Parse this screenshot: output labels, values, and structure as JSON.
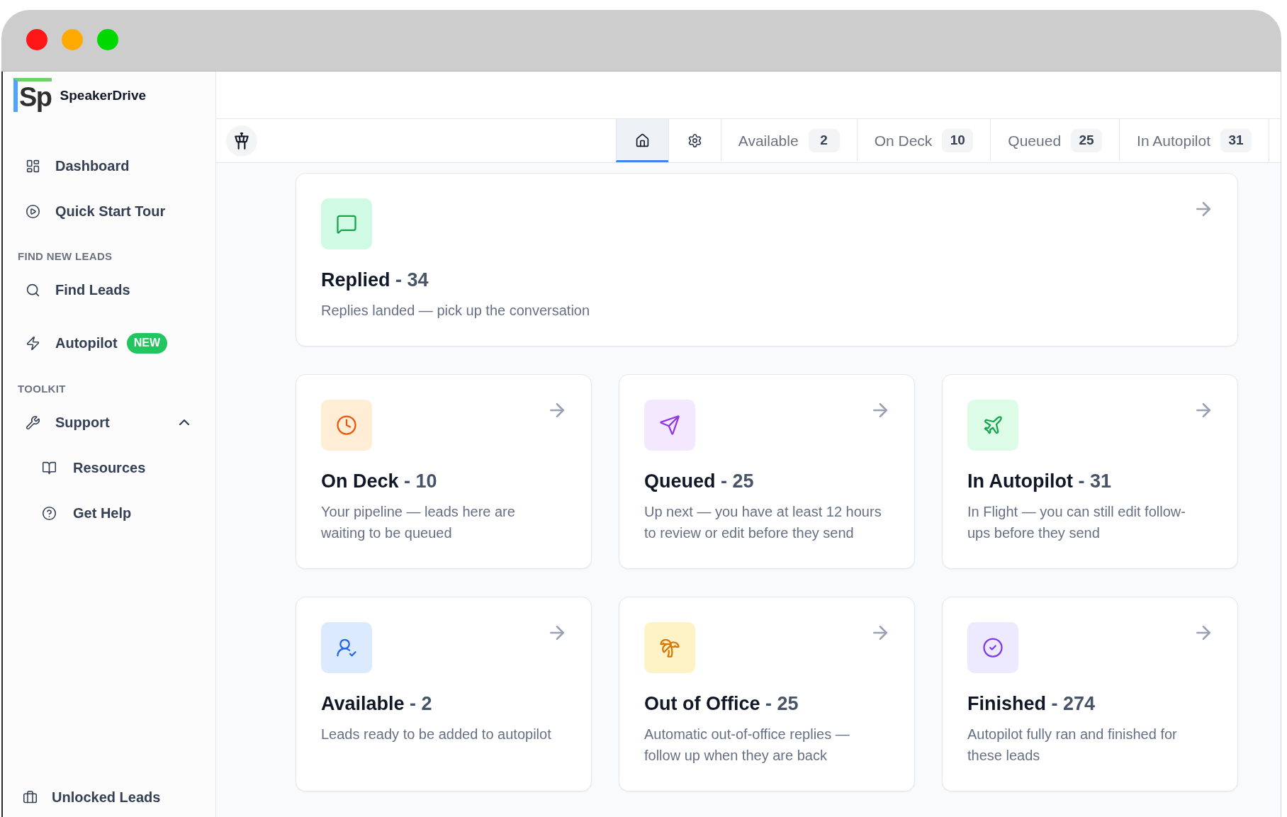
{
  "sidebar": {
    "brand": {
      "logo": "Sp",
      "name": "SpeakerDrive"
    },
    "sections": [
      {
        "items": [
          {
            "label": "Dashboard"
          },
          {
            "label": "Quick Start Tour"
          }
        ]
      },
      {
        "heading": "FIND NEW LEADS",
        "items": [
          {
            "label": "Find Leads"
          },
          {
            "label": "Autopilot",
            "badge": "NEW"
          }
        ]
      },
      {
        "heading": "TOOLKIT",
        "items": [
          {
            "label": "Support",
            "expanded": true,
            "children": [
              {
                "label": "Resources"
              },
              {
                "label": "Get Help"
              }
            ]
          }
        ]
      }
    ],
    "footer_item": {
      "label": "Unlocked Leads"
    }
  },
  "tabs": [
    {
      "kind": "icon",
      "selected": true
    },
    {
      "kind": "icon",
      "selected": false
    },
    {
      "kind": "count",
      "label": "Available",
      "count": "2",
      "selected": false
    },
    {
      "kind": "count",
      "label": "On Deck",
      "count": "10",
      "selected": false
    },
    {
      "kind": "count",
      "label": "Queued",
      "count": "25",
      "selected": false
    },
    {
      "kind": "count",
      "label": "In Autopilot",
      "count": "31",
      "selected": false
    }
  ],
  "cards": [
    {
      "title": "Replied",
      "count": "- 34",
      "description": "Replies landed — pick up the conversation"
    },
    {
      "title": "On Deck",
      "count": "- 10",
      "description": "Your pipeline — leads here are waiting to be queued"
    },
    {
      "title": "Queued",
      "count": "- 25",
      "description": "Up next — you have at least 12 hours to review or edit before they send"
    },
    {
      "title": "In Autopilot",
      "count": "- 31",
      "description": "In Flight — you can still edit follow-ups before they send"
    },
    {
      "title": "Available",
      "count": "- 2",
      "description": "Leads ready to be added to autopilot"
    },
    {
      "title": "Out of Office",
      "count": "- 25",
      "description": "Automatic out-of-office replies — follow up when they are back"
    },
    {
      "title": "Finished",
      "count": "- 274",
      "description": "Autopilot fully ran and finished for these leads"
    }
  ]
}
